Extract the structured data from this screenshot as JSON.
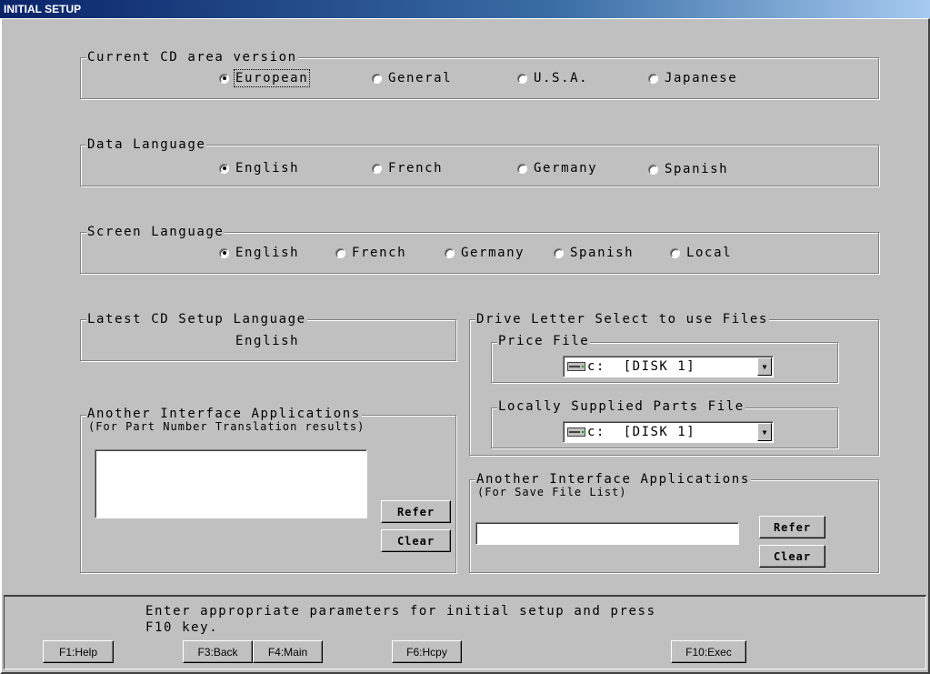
{
  "window": {
    "title": "INITIAL SETUP"
  },
  "cd_area": {
    "legend": "Current CD area version",
    "options": [
      "European",
      "General",
      "U.S.A.",
      "Japanese"
    ]
  },
  "data_language": {
    "legend": "Data Language",
    "options": [
      "English",
      "French",
      "Germany",
      "Spanish"
    ]
  },
  "screen_language": {
    "legend": "Screen Language",
    "options": [
      "English",
      "French",
      "Germany",
      "Spanish",
      "Local"
    ]
  },
  "latest_cd": {
    "legend": "Latest CD Setup Language",
    "value": "English"
  },
  "drive_select": {
    "legend": "Drive Letter Select to use Files",
    "price_file": {
      "legend": "Price File",
      "value": "c:  [DISK 1]"
    },
    "parts_file": {
      "legend": "Locally Supplied Parts File",
      "value": "c:  [DISK 1]"
    }
  },
  "interface_left": {
    "legend": "Another Interface Applications",
    "subtitle": "(For Part Number Translation results)",
    "refer": "Refer",
    "clear": "Clear"
  },
  "interface_right": {
    "legend": "Another Interface Applications",
    "subtitle": "(For Save File List)",
    "refer": "Refer",
    "clear": "Clear"
  },
  "status": {
    "line1": "Enter appropriate parameters for initial setup and press",
    "line2": "F10 key."
  },
  "fkeys": {
    "f1": "F1:Help",
    "f3": "F3:Back",
    "f4": "F4:Main",
    "f6": "F6:Hcpy",
    "f10": "F10:Exec"
  }
}
